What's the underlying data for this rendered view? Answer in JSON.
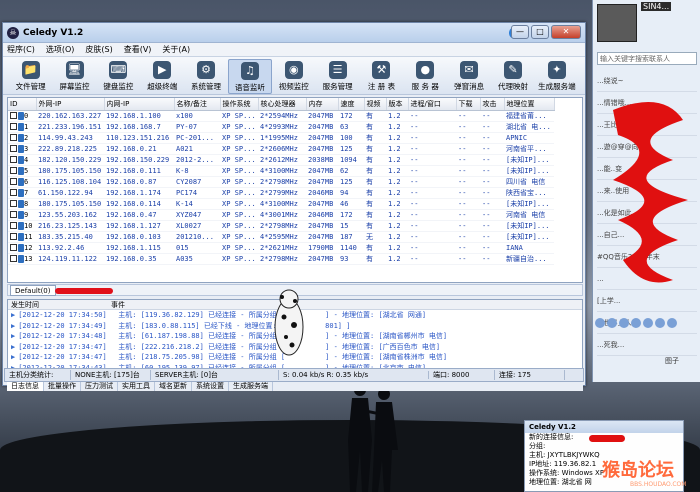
{
  "window": {
    "title": "Celedy V1.2",
    "min_label": "—",
    "max_label": "□",
    "close_label": "✕"
  },
  "menu": [
    "程序(C)",
    "选项(O)",
    "皮肤(S)",
    "查看(V)",
    "关于(A)"
  ],
  "toolbar": [
    {
      "label": "文件管理",
      "icon": "folder-icon",
      "glyph": "📁"
    },
    {
      "label": "屏幕监控",
      "icon": "monitor-icon",
      "glyph": "🖥"
    },
    {
      "label": "键盘监控",
      "icon": "keyboard-icon",
      "glyph": "⌨"
    },
    {
      "label": "超级终端",
      "icon": "terminal-icon",
      "glyph": "▶"
    },
    {
      "label": "系统管理",
      "icon": "gear-icon",
      "glyph": "⚙"
    },
    {
      "label": "语音监听",
      "icon": "speaker-icon",
      "glyph": "♫"
    },
    {
      "label": "视频监控",
      "icon": "camera-icon",
      "glyph": "◉"
    },
    {
      "label": "服务管理",
      "icon": "services-icon",
      "glyph": "☰"
    },
    {
      "label": "注 册 表",
      "icon": "registry-icon",
      "glyph": "⚒"
    },
    {
      "label": "服 务 器",
      "icon": "server-icon",
      "glyph": "●"
    },
    {
      "label": "弹窗消息",
      "icon": "message-icon",
      "glyph": "✉"
    },
    {
      "label": "代理映射",
      "icon": "proxy-icon",
      "glyph": "✎"
    },
    {
      "label": "生成服务端",
      "icon": "build-icon",
      "glyph": "✦"
    }
  ],
  "table": {
    "headers": [
      "ID",
      "外网-IP",
      "内网-IP",
      "名称/备注",
      "操作系统",
      "核心处理器",
      "内存",
      "速度",
      "视频",
      "版本",
      "进程/窗口",
      "下载",
      "攻击",
      "地理位置"
    ],
    "rows": [
      [
        "0",
        "220.162.163.227",
        "192.168.1.100",
        "x100",
        "XP SP...",
        "2*2594MHz",
        "2047MB",
        "172",
        "有",
        "1.2",
        "--",
        "--",
        "--",
        "福建省莆..."
      ],
      [
        "1",
        "221.233.196.151",
        "192.168.168.7",
        "PY-07",
        "XP SP...",
        "4*2993MHz",
        "2047MB",
        "63",
        "有",
        "1.2",
        "--",
        "--",
        "--",
        "湖北省 电..."
      ],
      [
        "2",
        "114.99.43.243",
        "110.123.151.216",
        "PC-201...",
        "XP SP...",
        "1*1995MHz",
        "2047MB",
        "100",
        "有",
        "1.2",
        "--",
        "--",
        "--",
        "APNIC"
      ],
      [
        "3",
        "222.89.218.225",
        "192.168.0.21",
        "A021",
        "XP SP...",
        "2*2606MHz",
        "2047MB",
        "125",
        "有",
        "1.2",
        "--",
        "--",
        "--",
        "河南省平..."
      ],
      [
        "4",
        "182.120.150.229",
        "192.168.150.229",
        "2012-2...",
        "XP SP...",
        "2*2612MHz",
        "2038MB",
        "1094",
        "有",
        "1.2",
        "--",
        "--",
        "--",
        "[未知IP]..."
      ],
      [
        "5",
        "180.175.105.150",
        "192.168.0.111",
        "K-8",
        "XP SP...",
        "4*3100MHz",
        "2047MB",
        "62",
        "有",
        "1.2",
        "--",
        "--",
        "--",
        "[未知IP]..."
      ],
      [
        "6",
        "116.125.108.104",
        "192.168.0.87",
        "CY2087",
        "XP SP...",
        "2*2798MHz",
        "2047MB",
        "125",
        "有",
        "1.2",
        "--",
        "--",
        "--",
        "四川省 电信"
      ],
      [
        "7",
        "61.150.122.94",
        "192.168.1.174",
        "PC174",
        "XP SP...",
        "2*2799MHz",
        "2046MB",
        "94",
        "有",
        "1.2",
        "--",
        "--",
        "--",
        "陕西省宝..."
      ],
      [
        "8",
        "180.175.105.150",
        "192.168.0.114",
        "K-14",
        "XP SP...",
        "4*3100MHz",
        "2047MB",
        "46",
        "有",
        "1.2",
        "--",
        "--",
        "--",
        "[未知IP]..."
      ],
      [
        "9",
        "123.55.203.162",
        "192.168.0.47",
        "XYZ047",
        "XP SP...",
        "4*3001MHz",
        "2046MB",
        "172",
        "有",
        "1.2",
        "--",
        "--",
        "--",
        "河南省 电信"
      ],
      [
        "10",
        "216.23.125.143",
        "192.168.1.127",
        "XL0027",
        "XP SP...",
        "2*2798MHz",
        "2047MB",
        "15",
        "有",
        "1.2",
        "--",
        "--",
        "--",
        "[未知IP]..."
      ],
      [
        "11",
        "183.35.215.40",
        "192.168.0.103",
        "201210...",
        "XP SP...",
        "4*2595MHz",
        "2047MB",
        "187",
        "无",
        "1.2",
        "--",
        "--",
        "--",
        "[未知IP]..."
      ],
      [
        "12",
        "113.92.2.46",
        "192.168.1.115",
        "015",
        "XP SP...",
        "2*2621MHz",
        "1790MB",
        "1140",
        "有",
        "1.2",
        "--",
        "--",
        "--",
        "IANA"
      ],
      [
        "13",
        "124.119.11.122",
        "192.168.0.35",
        "A035",
        "XP SP...",
        "2*2798MHz",
        "2047MB",
        "93",
        "有",
        "1.2",
        "--",
        "--",
        "--",
        "新疆自治..."
      ]
    ]
  },
  "group_tab": "Default(0)",
  "log": {
    "headers": [
      "发生时间",
      "事件"
    ],
    "rows": [
      [
        "[2012-12-20 17:34:50]",
        "主机: [119.36.82.129] 已经连接 - 所属分组 [",
        "] - 地理位置: [湖北省 网通]"
      ],
      [
        "[2012-12-20 17:34:49]",
        "主机: [183.0.88.115] 已经下线 - 地理位置: [",
        "801] ]"
      ],
      [
        "[2012-12-20 17:34:48]",
        "主机: [61.187.198.88] 已经连接 - 所属分组 [",
        "] - 地理位置: [湖南省郴州市 电信]"
      ],
      [
        "[2012-12-20 17:34:47]",
        "主机: [222.216.218.2] 已经连接 - 所属分组 [",
        "] - 地理位置: [广西百色市 电信]"
      ],
      [
        "[2012-12-20 17:34:47]",
        "主机: [218.75.205.98] 已经连接 - 所属分组 [",
        "] - 地理位置: [湖南省株洲市 电信]"
      ],
      [
        "[2012-12-20 17:34:43]",
        "主机: [60.195.139.97] 已经连接 - 所属分组 [",
        "] - 地理位置: [北京市 电信]"
      ]
    ]
  },
  "bottom_tabs": [
    "日志信息",
    "批量操作",
    "压力测试",
    "实用工具",
    "域名更新",
    "系统设置",
    "生成服务端"
  ],
  "status": [
    "主机分类统计:",
    "NONE主机: [175]台",
    "SERVER主机: [0]台",
    "S: 0.04 kb/s R: 0.35 kb/s",
    "端口: 8000",
    "连接: 175"
  ],
  "qq": {
    "top_text": "SIN4...",
    "search_placeholder": "输入关键字搜索联系人",
    "items": [
      "...绕说~",
      "...情错哦...",
      "...王比面我是否省",
      "...遊@穿@向",
      "...能..变",
      "...来..使用",
      "...化是如此..",
      "...自己...",
      "#QQ音乐2012年末",
      "...",
      "[上学...",
      "...世界上人",
      "...死我..."
    ],
    "bottom_label": "图子"
  },
  "popup": {
    "title": "Celedy V1.2",
    "lines": [
      "新的连接信息:",
      "分组:",
      "主机:      JXYTLBKJYWKQ",
      "IP地址:    119.36.82.1",
      "操作系统: Windows XP",
      "地理位置: 湖北省 网"
    ]
  },
  "watermark": {
    "main": "猴岛论坛",
    "sub": "BBS.HOUDAO.COM"
  },
  "colors": {
    "accent": "#2d6fc0",
    "row_text": "#1a3fa8",
    "scribble": "#e0101a",
    "log_text": "#2a56c6"
  }
}
